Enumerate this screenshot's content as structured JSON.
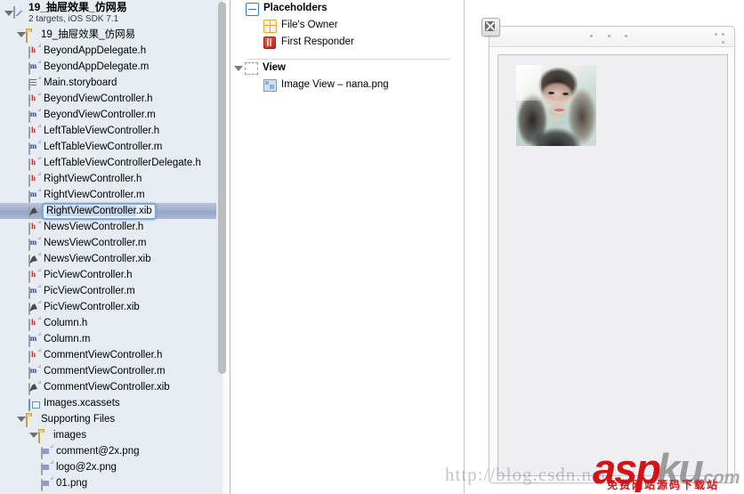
{
  "navigator": {
    "project": {
      "title": "19_抽屉效果_仿网易",
      "subtitle": "2 targets, iOS SDK 7.1"
    },
    "items": [
      {
        "label": "19_抽屉效果_仿网易",
        "icon": "folder-icon",
        "indent": 1,
        "twisty": true
      },
      {
        "label": "BeyondAppDelegate.h",
        "icon": "header-file-icon",
        "indent": 2
      },
      {
        "label": "BeyondAppDelegate.m",
        "icon": "source-file-icon",
        "indent": 2
      },
      {
        "label": "Main.storyboard",
        "icon": "storyboard-file-icon",
        "indent": 2
      },
      {
        "label": "BeyondViewController.h",
        "icon": "header-file-icon",
        "indent": 2
      },
      {
        "label": "BeyondViewController.m",
        "icon": "source-file-icon",
        "indent": 2
      },
      {
        "label": "LeftTableViewController.h",
        "icon": "header-file-icon",
        "indent": 2
      },
      {
        "label": "LeftTableViewController.m",
        "icon": "source-file-icon",
        "indent": 2
      },
      {
        "label": "LeftTableViewControllerDelegate.h",
        "icon": "header-file-icon",
        "indent": 2
      },
      {
        "label": "RightViewController.h",
        "icon": "header-file-icon",
        "indent": 2
      },
      {
        "label": "RightViewController.m",
        "icon": "source-file-icon",
        "indent": 2
      },
      {
        "label": "RightViewController.xib",
        "icon": "xib-file-icon",
        "indent": 2,
        "selected": true,
        "editing": true,
        "edit_selected_text": "RightViewController",
        "edit_trailing_text": ".xib"
      },
      {
        "label": "NewsViewController.h",
        "icon": "header-file-icon",
        "indent": 2
      },
      {
        "label": "NewsViewController.m",
        "icon": "source-file-icon",
        "indent": 2
      },
      {
        "label": "NewsViewController.xib",
        "icon": "xib-file-icon",
        "indent": 2
      },
      {
        "label": "PicViewController.h",
        "icon": "header-file-icon",
        "indent": 2
      },
      {
        "label": "PicViewController.m",
        "icon": "source-file-icon",
        "indent": 2
      },
      {
        "label": "PicViewController.xib",
        "icon": "xib-file-icon",
        "indent": 2
      },
      {
        "label": "Column.h",
        "icon": "header-file-icon",
        "indent": 2
      },
      {
        "label": "Column.m",
        "icon": "source-file-icon",
        "indent": 2
      },
      {
        "label": "CommentViewController.h",
        "icon": "header-file-icon",
        "indent": 2
      },
      {
        "label": "CommentViewController.m",
        "icon": "source-file-icon",
        "indent": 2
      },
      {
        "label": "CommentViewController.xib",
        "icon": "xib-file-icon",
        "indent": 2
      },
      {
        "label": "Images.xcassets",
        "icon": "assets-catalog-icon",
        "indent": 2
      },
      {
        "label": "Supporting Files",
        "icon": "folder-icon",
        "indent": 1,
        "twisty": true
      },
      {
        "label": "images",
        "icon": "folder-icon",
        "indent": 2,
        "twisty": true
      },
      {
        "label": "comment@2x.png",
        "icon": "png-image-icon",
        "indent": 3
      },
      {
        "label": "logo@2x.png",
        "icon": "png-image-icon",
        "indent": 3
      },
      {
        "label": "01.png",
        "icon": "png-image-icon",
        "indent": 3
      }
    ]
  },
  "outline": {
    "rows": [
      {
        "label": "Placeholders",
        "icon": "placeholders-cube-icon",
        "indent": 0,
        "bold": true
      },
      {
        "label": "File's Owner",
        "icon": "files-owner-icon",
        "indent": 1
      },
      {
        "label": "First Responder",
        "icon": "first-responder-icon",
        "indent": 1
      },
      {
        "label": "View",
        "icon": "view-icon",
        "indent": 0,
        "bold": true,
        "twisty": true
      },
      {
        "label": "Image View – nana.png",
        "icon": "image-view-icon",
        "indent": 1
      }
    ]
  },
  "canvas": {
    "close_button_label": "×"
  },
  "watermark": {
    "url": "http://blog.csdn.net/",
    "logo_asp": "asp",
    "logo_ku": "ku",
    "logo_com": ".com",
    "tagline": "免费网站源码下载站"
  },
  "colors": {
    "selection": "#9fadca",
    "accent_blue": "#7fa7d8",
    "header_red": "#c0272d",
    "source_blue": "#2b3fb0",
    "watermark_red": "#d51317"
  }
}
